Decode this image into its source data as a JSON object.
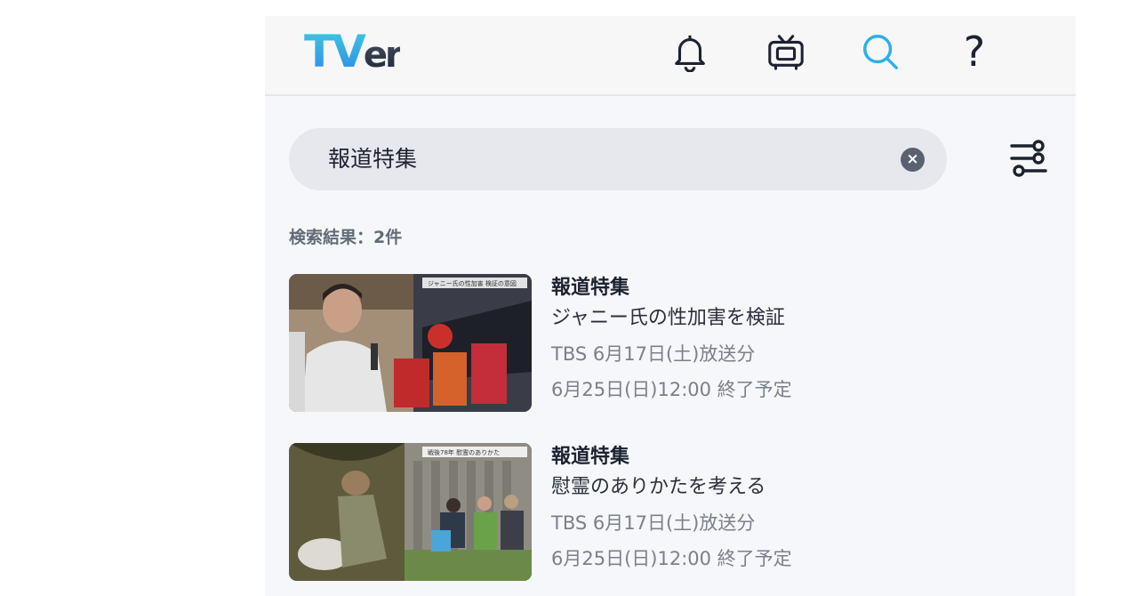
{
  "header": {
    "logo_main": "TV",
    "logo_suffix": "er",
    "icons": [
      "bell-icon",
      "tv-icon",
      "search-icon",
      "help-icon"
    ],
    "help_glyph": "?",
    "accent_color": "#2bb0e8"
  },
  "search": {
    "query": "報道特集",
    "clear_glyph": "×"
  },
  "results": {
    "count_label": "検索結果：2件",
    "items": [
      {
        "title": "報道特集",
        "subtitle": "ジャニー氏の性加害を検証",
        "broadcast": "TBS 6月17日(土)放送分",
        "end": "6月25日(日)12:00 終了予定",
        "thumb_caption": "ジャニー氏の性加害 検証の意図"
      },
      {
        "title": "報道特集",
        "subtitle": "慰霊のありかたを考える",
        "broadcast": "TBS 6月17日(土)放送分",
        "end": "6月25日(日)12:00 終了予定",
        "thumb_caption": "戦後78年 慰霊のありかた"
      }
    ]
  }
}
